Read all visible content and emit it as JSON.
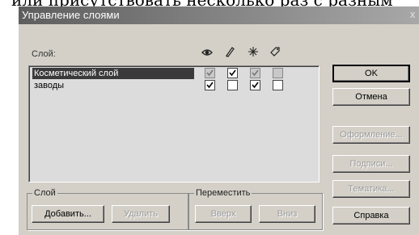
{
  "background_caption": "или присутствовать несколько раз с разным",
  "dialog": {
    "title": "Управление слоями",
    "close_glyph": "x"
  },
  "layers_label": "Слой:",
  "column_icons": [
    "eye-icon",
    "pencil-icon",
    "star-icon",
    "tag-icon"
  ],
  "layers": [
    {
      "name": "Косметический слой",
      "selected": true,
      "checks": [
        true,
        true,
        true,
        false
      ],
      "disabled": [
        true,
        false,
        true,
        true
      ]
    },
    {
      "name": "заводы",
      "selected": false,
      "checks": [
        true,
        false,
        true,
        false
      ],
      "disabled": [
        false,
        false,
        false,
        false
      ]
    }
  ],
  "buttons": {
    "ok": "OK",
    "cancel": "Отмена",
    "style": "Оформление...",
    "labels": "Подписи...",
    "thematic": "Тематика...",
    "help": "Справка"
  },
  "layer_group": {
    "label": "Слой",
    "add": "Добавить...",
    "remove": "Удалить"
  },
  "move_group": {
    "label": "Переместить",
    "up": "Вверх",
    "down": "Вниз"
  }
}
